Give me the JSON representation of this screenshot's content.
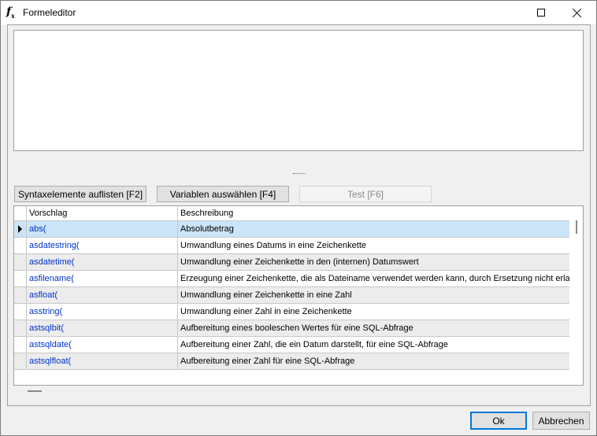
{
  "window": {
    "icon": "function-fx-icon",
    "title": "Formeleditor"
  },
  "editor": {
    "value": ""
  },
  "toolbar": {
    "syntax_label": "Syntaxelemente auflisten [F2]",
    "vars_label": "Variablen auswählen [F4]",
    "test_label": "Test [F6]"
  },
  "grid": {
    "columns": [
      "Vorschlag",
      "Beschreibung"
    ],
    "rows": [
      {
        "name": "abs(",
        "desc": "Absolutbetrag"
      },
      {
        "name": "asdatestring(",
        "desc": "Umwandlung eines Datums in eine Zeichenkette"
      },
      {
        "name": "asdatetime(",
        "desc": "Umwandlung einer Zeichenkette in den (internen) Datumswert"
      },
      {
        "name": "asfilename(",
        "desc": "Erzeugung einer Zeichenkette, die als Dateiname verwendet werden kann, durch Ersetzung nicht erlaubter"
      },
      {
        "name": "asfloat(",
        "desc": "Umwandlung einer Zeichenkette in eine Zahl"
      },
      {
        "name": "asstring(",
        "desc": "Umwandlung einer Zahl in eine Zeichenkette"
      },
      {
        "name": "astsqlbit(",
        "desc": "Aufbereitung eines booleschen Wertes für eine SQL-Abfrage"
      },
      {
        "name": "astsqldate(",
        "desc": "Aufbereitung einer Zahl, die ein Datum darstellt, für eine SQL-Abfrage"
      },
      {
        "name": "astsqlfloat(",
        "desc": "Aufbereitung einer Zahl für eine SQL-Abfrage"
      }
    ],
    "selected_index": 0
  },
  "footer": {
    "ok_label": "Ok",
    "cancel_label": "Abbrechen"
  },
  "colors": {
    "selected_row": "#cce4f7",
    "link_text": "#0033cc",
    "focus_border": "#0078d7"
  }
}
